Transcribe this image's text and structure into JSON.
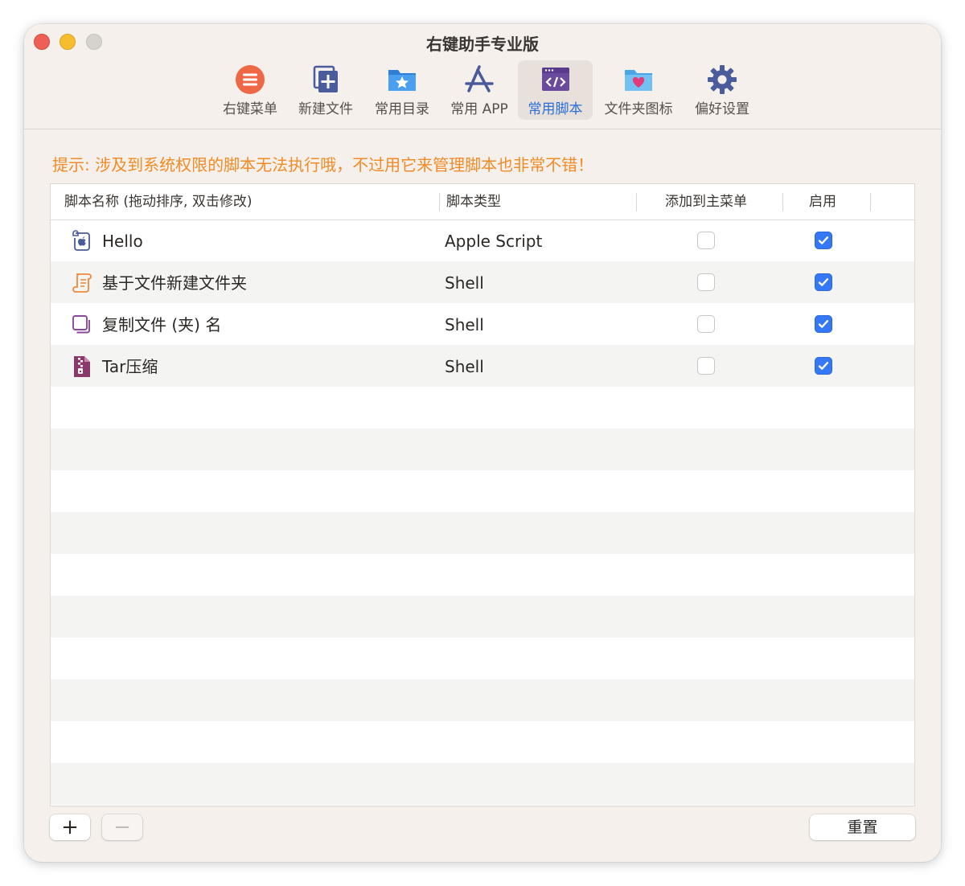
{
  "window": {
    "title": "右键助手专业版"
  },
  "toolbar": {
    "items": [
      {
        "label": "右键菜单",
        "icon": "menu-circle-icon",
        "color": "#ee6845"
      },
      {
        "label": "新建文件",
        "icon": "new-file-icon",
        "color": "#4b5c9c"
      },
      {
        "label": "常用目录",
        "icon": "folder-star-icon",
        "color": "#3d8fe0"
      },
      {
        "label": "常用 APP",
        "icon": "app-store-icon",
        "color": "#4a5a9a"
      },
      {
        "label": "常用脚本",
        "icon": "script-window-icon",
        "color": "#6a4a9c",
        "active": true
      },
      {
        "label": "文件夹图标",
        "icon": "folder-heart-icon",
        "color": "#5cb3ea"
      },
      {
        "label": "偏好设置",
        "icon": "gear-icon",
        "color": "#4b5c9c"
      }
    ]
  },
  "hint": "提示: 涉及到系统权限的脚本无法执行哦，不过用它来管理脚本也非常不错！",
  "table": {
    "headers": {
      "name": "脚本名称 (拖动排序, 双击修改)",
      "type": "脚本类型",
      "add_to_main": "添加到主菜单",
      "enabled": "启用"
    },
    "rows": [
      {
        "name": "Hello",
        "type": "Apple Script",
        "add_to_main": false,
        "enabled": true,
        "icon": "applescript-icon"
      },
      {
        "name": "基于文件新建文件夹",
        "type": "Shell",
        "add_to_main": false,
        "enabled": true,
        "icon": "scroll-icon"
      },
      {
        "name": "复制文件 (夹) 名",
        "type": "Shell",
        "add_to_main": false,
        "enabled": true,
        "icon": "copy-icon"
      },
      {
        "name": "Tar压缩",
        "type": "Shell",
        "add_to_main": false,
        "enabled": true,
        "icon": "archive-icon"
      }
    ]
  },
  "buttons": {
    "add": "+",
    "remove": "−",
    "reset": "重置"
  }
}
